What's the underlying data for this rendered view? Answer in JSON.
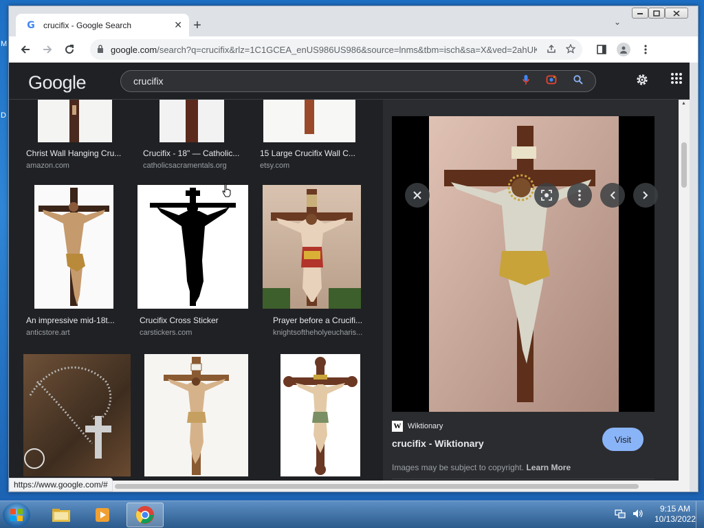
{
  "desktop": {
    "glyph1": "M",
    "glyph2": "D"
  },
  "browser": {
    "tab_title": "crucifix - Google Search",
    "tab_favicon": "G",
    "tab_close": "✕",
    "new_tab": "+",
    "tab_search": "⌄",
    "url_host": "google.com",
    "url_rest": "/search?q=crucifix&rlz=1C1GCEA_enUS986US986&source=lnms&tbm=isch&sa=X&ved=2ahUK...",
    "status_url": "https://www.google.com/#"
  },
  "google": {
    "logo": "Google",
    "search_value": "crucifix"
  },
  "results": [
    {
      "title": "Christ Wall Hanging Cru...",
      "site": "amazon.com"
    },
    {
      "title": "Crucifix - 18\" — Catholic...",
      "site": "catholicsacramentals.org"
    },
    {
      "title": "15 Large Crucifix Wall C...",
      "site": "etsy.com"
    },
    {
      "title": "An impressive mid-18t...",
      "site": "anticstore.art"
    },
    {
      "title": "Crucifix Cross Sticker",
      "site": "carstickers.com"
    },
    {
      "title": "Prayer before a Crucifi...",
      "site": "knightsoftheholyeucharis..."
    }
  ],
  "preview": {
    "source_site": "Wiktionary",
    "source_logo": "W",
    "title": "crucifix - Wiktionary",
    "visit_label": "Visit",
    "copyright_text": "Images may be subject to copyright.",
    "learn_more": "Learn More"
  },
  "taskbar": {
    "time": "9:15 AM",
    "date": "10/13/2022"
  }
}
